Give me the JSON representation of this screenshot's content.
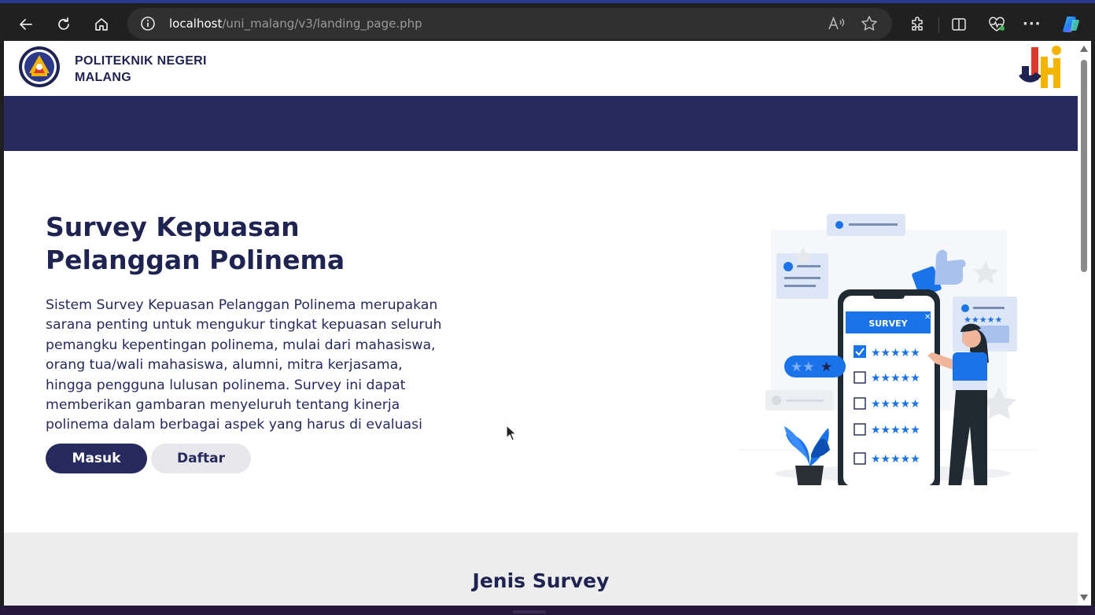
{
  "browser": {
    "url_host": "localhost",
    "url_path": "/uni_malang/v3/landing_page.php",
    "icons": [
      "back-icon",
      "refresh-icon",
      "home-icon",
      "info-icon",
      "read-aloud-icon",
      "favorite-star-icon",
      "extensions-icon",
      "split-screen-icon",
      "browser-essentials-icon",
      "more-icon",
      "copilot-icon"
    ]
  },
  "header": {
    "brand_line1": "POLITEKNIK NEGERI",
    "brand_line2": "MALANG"
  },
  "hero": {
    "title_line1": "Survey Kepuasan",
    "title_line2": "Pelanggan Polinema",
    "description_lines": [
      "Sistem Survey Kepuasan Pelanggan Polinema merupakan",
      "sarana penting untuk mengukur tingkat kepuasan seluruh",
      "pemangku kepentingan polinema, mulai dari mahasiswa,",
      "orang tua/wali mahasiswa, alumni, mitra kerjasama,",
      "hingga pengguna lulusan polinema. Survey ini dapat",
      "memberikan gambaran menyeluruh tentang kinerja",
      "polinema dalam berbagai aspek yang harus di evaluasi"
    ],
    "btn_masuk": "Masuk",
    "btn_daftar": "Daftar",
    "illustration_label": "SURVEY"
  },
  "sections": {
    "jenis_survey_title": "Jenis Survey"
  },
  "colors": {
    "primary": "#262a5e",
    "accent_blue": "#1a73e8",
    "grey_section": "#ededed"
  }
}
